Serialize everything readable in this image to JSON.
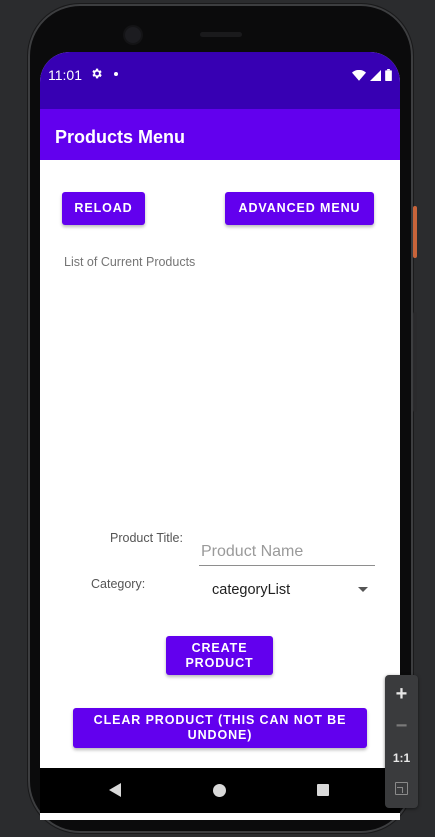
{
  "status_bar": {
    "time": "11:01",
    "settings_icon": "gear-icon",
    "notification_icon": "dot-icon",
    "wifi_icon": "wifi-icon",
    "signal_icon": "signal-icon",
    "battery_icon": "battery-icon"
  },
  "app_bar": {
    "title": "Products Menu"
  },
  "main": {
    "reload_label": "RELOAD",
    "advanced_menu_label": "ADVANCED MENU",
    "list_label": "List of Current Products",
    "product_title_label": "Product Title:",
    "product_name_placeholder": "Product Name",
    "product_name_value": "",
    "category_label": "Category:",
    "category_selected": "categoryList",
    "create_product_label": "CREATE PRODUCT",
    "clear_product_label": "CLEAR PRODUCT (THIS CAN NOT BE UNDONE)"
  },
  "nav_bar": {
    "back_icon": "back-triangle-icon",
    "home_icon": "home-circle-icon",
    "recents_icon": "recents-square-icon"
  },
  "zoom_controls": {
    "zoom_in": "+",
    "zoom_out": "−",
    "actual_size": "1:1",
    "fit_icon": "fit-screen-icon"
  },
  "colors": {
    "status_bar": "#3700b3",
    "primary": "#6200ee",
    "on_primary": "#ffffff"
  }
}
